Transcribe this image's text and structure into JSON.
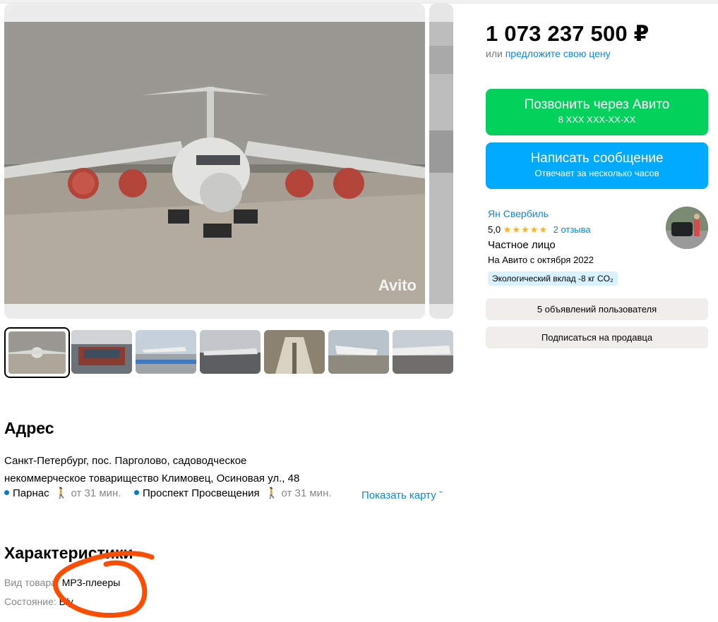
{
  "listing": {
    "price": "1 073 237 500 ₽",
    "offer_prefix": "или",
    "offer_link": "предложите свою цену",
    "watermark": "Avito"
  },
  "buttons": {
    "call_title": "Позвонить через Авито",
    "call_phone": "8 XXX XXX-XX-XX",
    "message_title": "Написать сообщение",
    "message_subtitle": "Отвечает за несколько часов",
    "user_ads": "5 объявлений пользователя",
    "subscribe": "Подписаться на продавца"
  },
  "seller": {
    "name": "Ян Свербиль",
    "rating": "5,0",
    "stars": "★★★★★",
    "reviews": "2 отзыва",
    "type": "Частное лицо",
    "since": "На Авито с октября 2022",
    "eco": "Экологический вклад -8 кг CO₂"
  },
  "address": {
    "title": "Адрес",
    "line1": "Санкт-Петербург, пос. Парголово, садоводческое",
    "line2": "некоммерческое товарищество Климовец, Осиновая ул., 48",
    "metro": [
      {
        "station": "Парнас",
        "walk": "от 31 мин."
      },
      {
        "station": "Проспект Просвещения",
        "walk": "от 31 мин."
      }
    ],
    "show_map": "Показать карту"
  },
  "characteristics": {
    "title": "Характеристики",
    "items": [
      {
        "key": "Вид товара:",
        "value": "MP3-плееры"
      },
      {
        "key": "Состояние:",
        "value": "Б/у"
      }
    ]
  },
  "colors": {
    "call_button": "#02d15c",
    "message_button": "#00aaff",
    "link": "#0a8bd8",
    "annotation": "#ff4d00"
  }
}
